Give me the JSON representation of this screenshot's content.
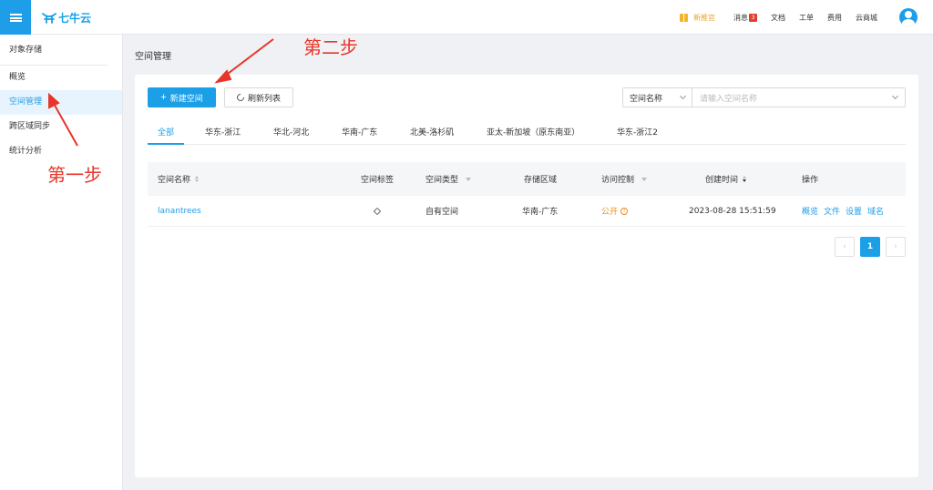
{
  "topbar": {
    "logo_text": "七牛云",
    "items": [
      {
        "label": "新推官",
        "icon": "gift-icon"
      },
      {
        "label": "消息",
        "badge": "3"
      },
      {
        "label": "文档"
      },
      {
        "label": "工单"
      },
      {
        "label": "费用"
      },
      {
        "label": "云商城"
      }
    ],
    "colors": {
      "accent": "#1e9ee8",
      "orange": "#f08c1a",
      "annotation": "#e8352a"
    }
  },
  "sidebar": {
    "header": "对象存储",
    "items": [
      {
        "label": "概览",
        "active": false
      },
      {
        "label": "空间管理",
        "active": true
      },
      {
        "label": "跨区域同步",
        "active": false
      },
      {
        "label": "统计分析",
        "active": false
      }
    ]
  },
  "page": {
    "title": "空间管理",
    "new_button": "新建空间",
    "refresh_button": "刷新列表",
    "search": {
      "field": "空间名称",
      "placeholder": "请输入空间名称"
    },
    "tabs": [
      "全部",
      "华东-浙江",
      "华北-河北",
      "华南-广东",
      "北美-洛杉矶",
      "亚太-新加坡（原东南亚）",
      "华东-浙江2"
    ],
    "table": {
      "headers": [
        "空间名称",
        "空间标签",
        "空间类型",
        "存储区域",
        "访问控制",
        "创建时间",
        "操作"
      ],
      "rows": [
        {
          "name": "lanantrees",
          "type": "自有空间",
          "region": "华南-广东",
          "access": "公开",
          "created": "2023-08-28 15:51:59",
          "actions": [
            "概览",
            "文件",
            "设置",
            "域名"
          ]
        }
      ]
    },
    "pagination": {
      "current": "1"
    }
  },
  "annotations": {
    "step1": "第一步",
    "step2": "第二步"
  }
}
